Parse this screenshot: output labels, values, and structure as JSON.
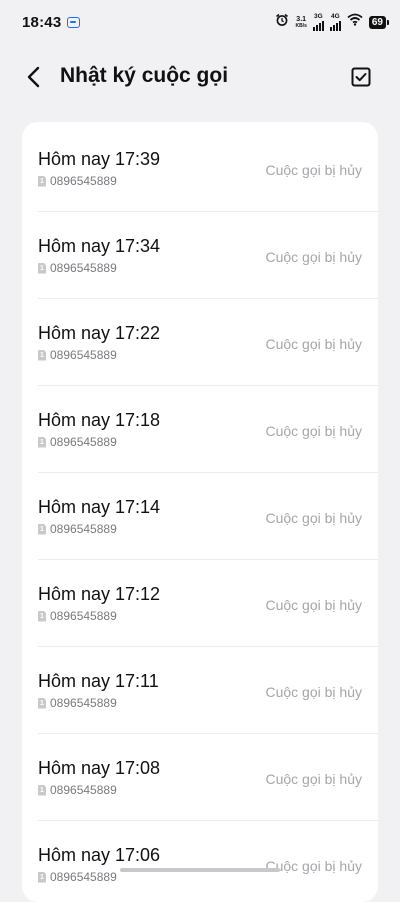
{
  "status_bar": {
    "time": "18:43",
    "net_speed_value": "3.1",
    "net_speed_unit": "KB/s",
    "signal1_label": "3G",
    "signal2_label": "4G",
    "battery": "69"
  },
  "header": {
    "title": "Nhật ký cuộc gọi"
  },
  "calls": [
    {
      "time": "Hôm nay 17:39",
      "number": "0896545889",
      "status": "Cuộc gọi bị hủy",
      "sim": "1"
    },
    {
      "time": "Hôm nay 17:34",
      "number": "0896545889",
      "status": "Cuộc gọi bị hủy",
      "sim": "1"
    },
    {
      "time": "Hôm nay 17:22",
      "number": "0896545889",
      "status": "Cuộc gọi bị hủy",
      "sim": "1"
    },
    {
      "time": "Hôm nay 17:18",
      "number": "0896545889",
      "status": "Cuộc gọi bị hủy",
      "sim": "1"
    },
    {
      "time": "Hôm nay 17:14",
      "number": "0896545889",
      "status": "Cuộc gọi bị hủy",
      "sim": "1"
    },
    {
      "time": "Hôm nay 17:12",
      "number": "0896545889",
      "status": "Cuộc gọi bị hủy",
      "sim": "1"
    },
    {
      "time": "Hôm nay 17:11",
      "number": "0896545889",
      "status": "Cuộc gọi bị hủy",
      "sim": "1"
    },
    {
      "time": "Hôm nay 17:08",
      "number": "0896545889",
      "status": "Cuộc gọi bị hủy",
      "sim": "1"
    },
    {
      "time": "Hôm nay 17:06",
      "number": "0896545889",
      "status": "Cuộc gọi bị hủy",
      "sim": "1"
    }
  ],
  "icons": {
    "back": "chevron-left-icon",
    "select": "checkbox-icon",
    "alarm": "alarm-icon",
    "wifi": "wifi-icon",
    "sim": "sim-card-icon"
  },
  "colors": {
    "background": "#f1f1f4",
    "card": "#ffffff",
    "status_text": "#a6a6aa",
    "number_text": "#7a7a7e"
  }
}
